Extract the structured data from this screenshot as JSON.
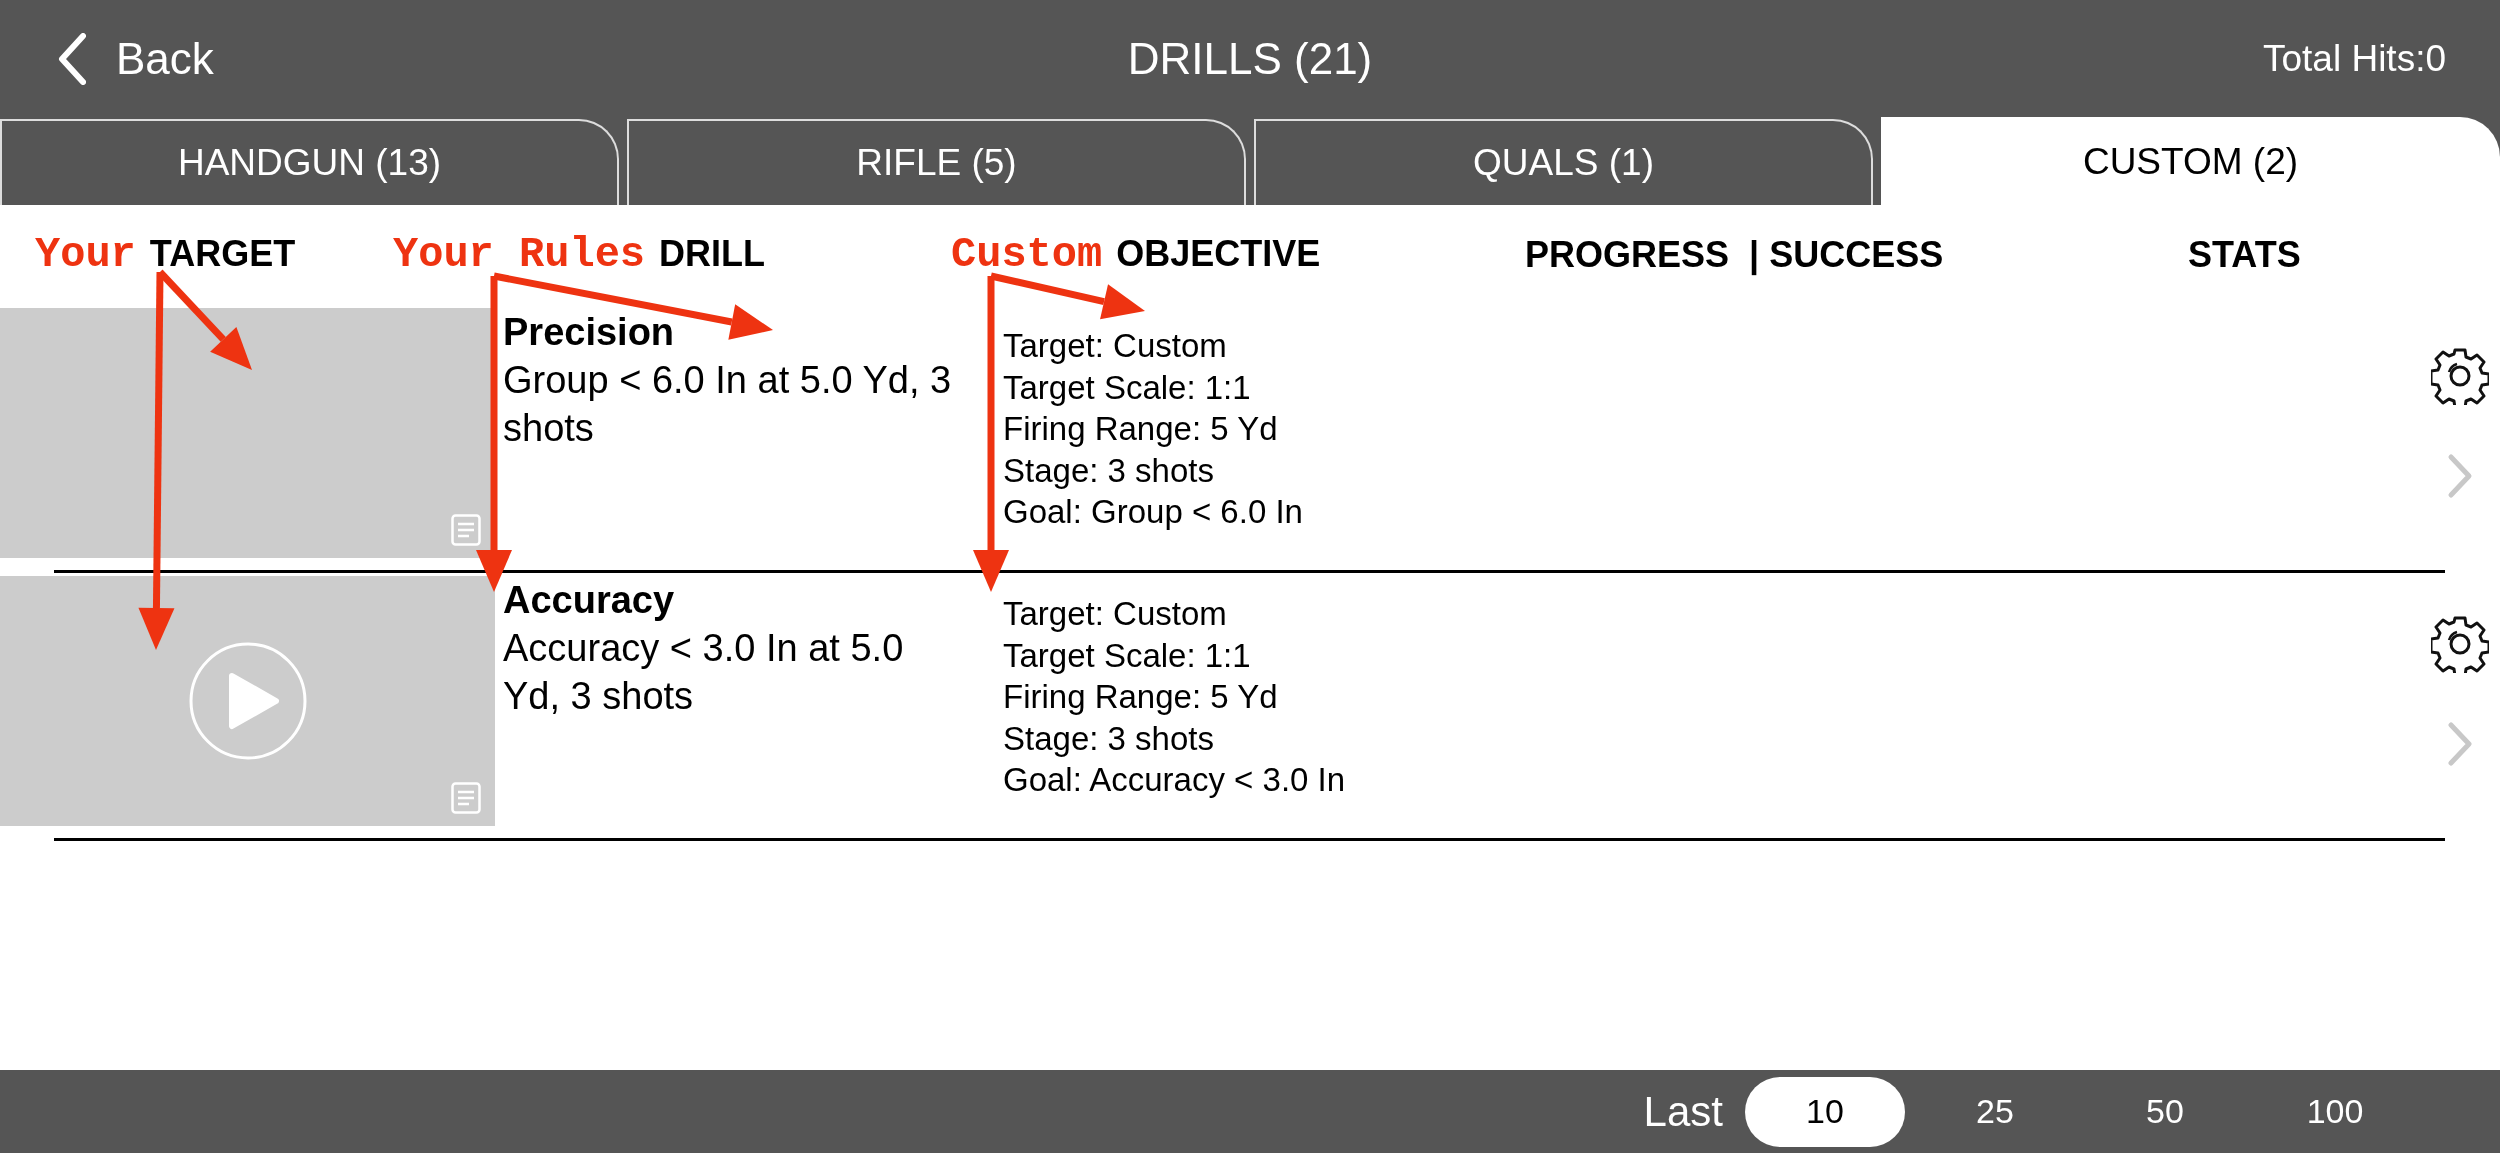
{
  "top_bar": {
    "back_label": "Back",
    "title": "DRILLS (21)",
    "total_hits": "Total Hits:0"
  },
  "tabs": [
    {
      "label": "HANDGUN (13)",
      "selected": false
    },
    {
      "label": "RIFLE (5)",
      "selected": false
    },
    {
      "label": "QUALS (1)",
      "selected": false
    },
    {
      "label": "CUSTOM (2)",
      "selected": true
    }
  ],
  "columns": [
    {
      "annotation": "Your",
      "label": "TARGET"
    },
    {
      "annotation": "Your Rules",
      "label": "DRILL"
    },
    {
      "annotation": "Custom",
      "label": "OBJECTIVE"
    },
    {
      "label": "PROGRESS  | SUCCESS"
    },
    {
      "label": "STATS"
    }
  ],
  "drills": [
    {
      "name": "Precision",
      "description": "Group < 6.0 In at 5.0 Yd, 3 shots",
      "video": false,
      "objective": [
        "Target: Custom",
        "Target Scale: 1:1",
        "Firing Range: 5 Yd",
        "Stage: 3 shots",
        "Goal: Group < 6.0 In"
      ]
    },
    {
      "name": "Accuracy",
      "description": "Accuracy < 3.0 In at 5.0 Yd, 3 shots",
      "video": true,
      "objective": [
        "Target: Custom",
        "Target Scale: 1:1",
        "Firing Range: 5 Yd",
        "Stage: 3 shots",
        "Goal: Accuracy < 3.0 In"
      ]
    }
  ],
  "footer": {
    "label": "Last",
    "options": [
      {
        "label": "10",
        "selected": true
      },
      {
        "label": "25",
        "selected": false
      },
      {
        "label": "50",
        "selected": false
      },
      {
        "label": "100",
        "selected": false
      }
    ]
  }
}
